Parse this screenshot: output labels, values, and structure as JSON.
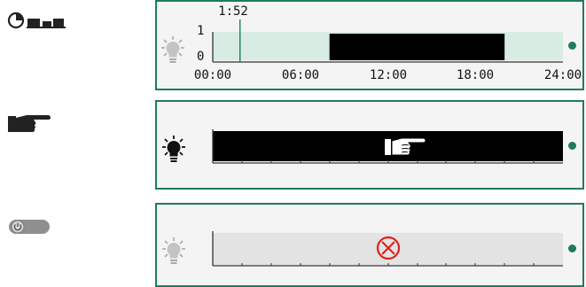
{
  "colors": {
    "accent": "#1f7a63",
    "panel_bg": "#f4f4f4",
    "schedule_track": "#d8ece3",
    "on_bar": "#000000",
    "off_track": "#e3e3e3",
    "error": "#e02020"
  },
  "rows": [
    {
      "mode_icon": "timer-schedule-icon",
      "status_icon": "lightbulb-off-icon",
      "current_time": "1:52",
      "current_time_hours": 1.867,
      "y_labels": [
        "1",
        "0"
      ],
      "x_labels": [
        "00:00",
        "06:00",
        "12:00",
        "18:00",
        "24:00"
      ],
      "on_interval_hours": [
        8,
        20
      ]
    },
    {
      "mode_icon": "manual-hand-icon",
      "status_icon": "lightbulb-on-icon",
      "bar_state": "on",
      "bar_icon": "pointing-hand-icon"
    },
    {
      "mode_icon": "power-toggle-icon",
      "status_icon": "lightbulb-off-icon",
      "bar_state": "off",
      "bar_icon": "error-x-icon"
    }
  ]
}
